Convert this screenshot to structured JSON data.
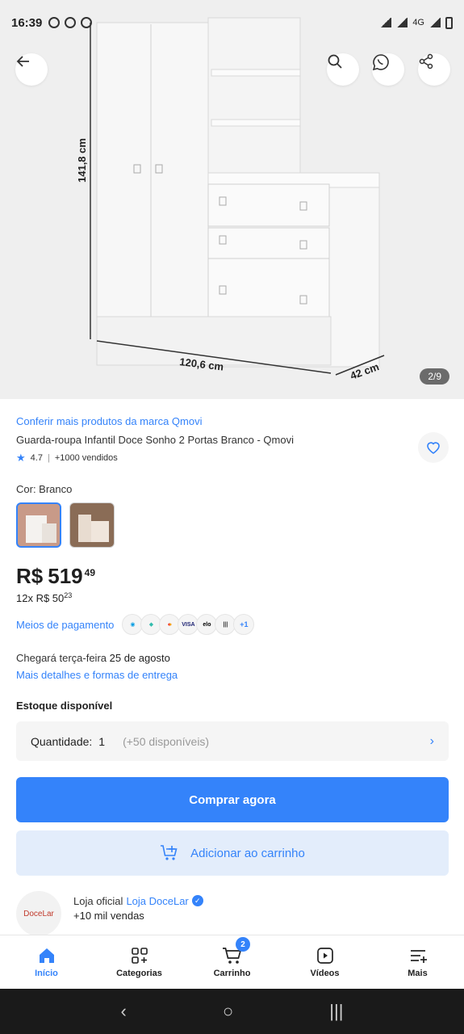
{
  "status_bar": {
    "time": "16:39",
    "network": "4G"
  },
  "gallery": {
    "counter": "2/9",
    "dimension_height": "141,8 cm",
    "dimension_width": "120,6 cm",
    "dimension_depth": "42 cm"
  },
  "product": {
    "brand_link": "Conferir mais produtos da marca Qmovi",
    "title": "Guarda-roupa Infantil Doce Sonho 2 Portas Branco - Qmovi",
    "rating": "4.7",
    "sold": "+1000 vendidos",
    "color_label": "Cor: Branco"
  },
  "price": {
    "currency": "R$",
    "integer": "519",
    "cents": "49",
    "installments_prefix": "12x R$ 50",
    "installments_cents": "23"
  },
  "payment": {
    "link": "Meios de pagamento",
    "icons": [
      "mercadopago-icon",
      "pix-icon",
      "mastercard-icon",
      "visa-icon",
      "elo-icon",
      "boleto-icon"
    ],
    "more": "+1"
  },
  "delivery": {
    "prefix": "Chegará terça-feira ",
    "date": "25 de agosto",
    "details_link": "Mais detalhes e formas de entrega"
  },
  "stock": {
    "label": "Estoque disponível",
    "qty_label": "Quantidade:",
    "qty_value": "1",
    "qty_available": "(+50 disponíveis)"
  },
  "actions": {
    "buy": "Comprar agora",
    "add_to_cart": "Adicionar ao carrinho"
  },
  "store": {
    "prefix": "Loja oficial",
    "name": "Loja DoceLar",
    "sales": "+10 mil vendas",
    "logo_text": "DoceLar"
  },
  "bottom_nav": {
    "items": [
      {
        "label": "Início",
        "icon": "home-icon"
      },
      {
        "label": "Categorias",
        "icon": "categories-icon"
      },
      {
        "label": "Carrinho",
        "icon": "cart-icon",
        "badge": "2"
      },
      {
        "label": "Vídeos",
        "icon": "video-icon"
      },
      {
        "label": "Mais",
        "icon": "menu-icon"
      }
    ]
  },
  "colors": {
    "accent": "#3483fa",
    "accent_light": "#e3edfb"
  }
}
